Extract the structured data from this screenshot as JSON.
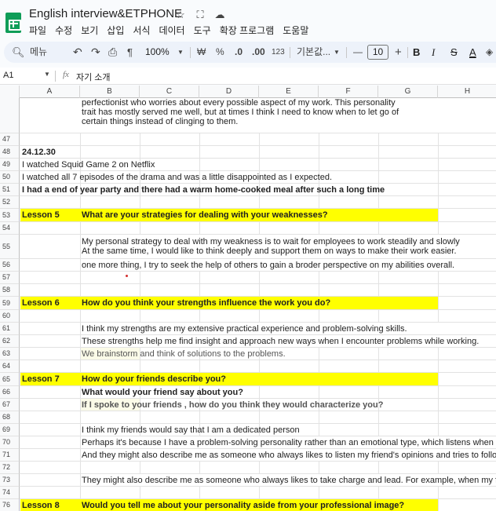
{
  "app": {
    "title": "English interview&ETPHONE",
    "title_icons": [
      "star-icon",
      "folder-move-icon",
      "cloud-status-icon"
    ],
    "menu": [
      "파일",
      "수정",
      "보기",
      "삽입",
      "서식",
      "데이터",
      "도구",
      "확장 프로그램",
      "도움말"
    ]
  },
  "toolbar": {
    "search_label": "메뉴",
    "undo": "↶",
    "redo": "↷",
    "print": "⎙",
    "paint": "¶",
    "zoom": "100%",
    "currency": "₩",
    "percent": "%",
    "dec_decrease": ".0",
    "dec_increase": ".00",
    "number_format": "123",
    "font": "기본값...",
    "minus": "—",
    "font_size": "10",
    "plus": "+",
    "bold": "B",
    "italic": "I",
    "strike": "S",
    "text_color": "A"
  },
  "formula": {
    "cell_ref": "A1",
    "fx": "fx",
    "value": "자기 소개"
  },
  "columns": [
    "A",
    "B",
    "C",
    "D",
    "E",
    "F",
    "G",
    "H"
  ],
  "rows": {
    "top_text_lines": [
      "perfectionist who worries about every possible aspect of my work. This personality",
      "trait has mostly served me well, but at times I think I need to know when to let go of",
      "certain things instead of clinging to them."
    ],
    "r47": "47",
    "r48": "48",
    "r49": "49",
    "r50": "50",
    "r51": "51",
    "r52": "52",
    "r53": "53",
    "r54": "54",
    "r55": "55",
    "r56": "56",
    "r57": "57",
    "r58": "58",
    "r59": "59",
    "r60": "60",
    "r61": "61",
    "r62": "62",
    "r63": "63",
    "r64": "64",
    "r65": "65",
    "r66": "66",
    "r67": "67",
    "r68": "68",
    "r69": "69",
    "r70": "70",
    "r71": "71",
    "r72": "72",
    "r73": "73",
    "r74": "74",
    "r75": "75",
    "r76": "76",
    "date": "24.12.30",
    "line49": "I watched Squid Game 2 on Netflix",
    "line50": "I watched all 7 episodes of the drama and was a little disappointed as I expected.",
    "line51": " I had a end of year party and there had a warm home-cooked meal after such a long time",
    "lesson5": "Lesson 5",
    "q5": "What are your strategies for dealing with your weaknesses?",
    "line55a": "My personal strategy to deal with my weakness is to wait for employees to work steadily and slowly",
    "line55b": "At the same time, I would like to think deeply and support them on ways to make their work easier.",
    "line56": "one more thing, I try to seek the help of others to gain a broder perspective on my abilities overall.",
    "lesson6": "Lesson 6",
    "q6": "How do you think your strengths influence the work you do?",
    "line61": "I think my strengths are my extensive practical experience and problem-solving skills.",
    "line62": "These strengths help me find insight and approach new ways when I encounter problems while working.",
    "line63": "We brainstorm and think of solutions to the problems.",
    "lesson7": "Lesson 7",
    "q7": "How do your friends describe you?",
    "q7b": "What would your friend say about you?",
    "q7c": "If I spoke  to your friends , how do you think they would characterize you?",
    "line69": "I think my friends would say that I am a dedicated person",
    "line70": "Perhaps it's because I have a problem-solving personality rather than an emotional type, which listens when someone h",
    "line71": "And they might also describe me as someone who always likes to listen my friend's opinions and tries to follow my frie",
    "line73": " They might also describe me as someone who always likes to take charge and lead. For example, when my friends and",
    "lesson8": "Lesson 8",
    "q8": "Would you tell me about your personality aside from your professional image?"
  },
  "colors": {
    "highlight": "#ffff00",
    "sheets_green": "#0f9d58",
    "toolbar_bg": "#edf2fa"
  }
}
